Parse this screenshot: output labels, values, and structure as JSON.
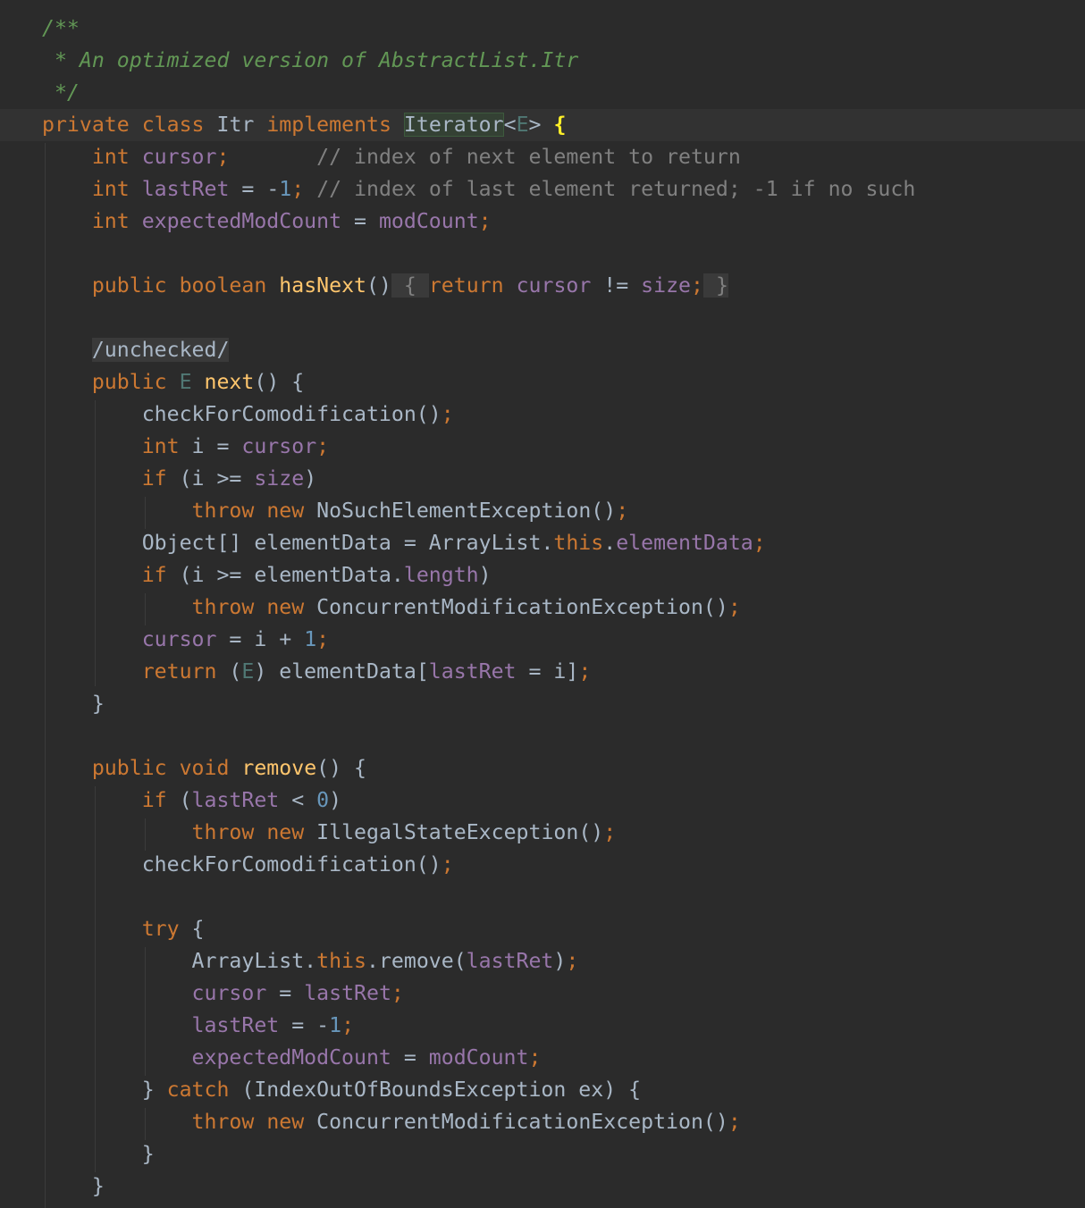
{
  "editor": {
    "colors": {
      "background": "#2b2b2b",
      "current_line": "#323232",
      "keyword": "#cc7832",
      "field": "#9876aa",
      "number": "#6897bb",
      "comment": "#808080",
      "doc_comment": "#629755",
      "method_decl": "#ffc66d",
      "type_param": "#507874",
      "default_text": "#a9b7c6"
    },
    "tokens": {
      "l1_doc": "/**",
      "l2_doc": " * An optimized version of AbstractList.Itr",
      "l3_doc": " */",
      "l4_private": "private",
      "l4_class": "class",
      "l4_name": "Itr",
      "l4_implements": "implements",
      "l4_iface": "Iterator",
      "l4_lt": "<",
      "l4_tp": "E",
      "l4_gt": ">",
      "l4_brace": "{",
      "l5_int": "int",
      "l5_field": "cursor",
      "l5_semi": ";",
      "l5_comment": "// index of next element to return",
      "l6_int": "int",
      "l6_field": "lastRet",
      "l6_eq": " = ",
      "l6_minus": "-",
      "l6_num": "1",
      "l6_semi": ";",
      "l6_comment": "// index of last element returned; -1 if no such",
      "l7_int": "int",
      "l7_field": "expectedModCount",
      "l7_eq": " = ",
      "l7_val": "modCount",
      "l7_semi": ";",
      "l8_public": "public",
      "l8_boolean": "boolean",
      "l8_method": "hasNext",
      "l8_parens": "()",
      "l8_open": " { ",
      "l8_return": "return",
      "l8_cursor": "cursor",
      "l8_ne": " != ",
      "l8_size": "size",
      "l8_semi": ";",
      "l8_close": " }",
      "l9_region": "/unchecked/",
      "l10_public": "public",
      "l10_tp": "E",
      "l10_method": "next",
      "l10_rest": "() {",
      "l11_call": "checkForComodification()",
      "l11_semi": ";",
      "l12_int": "int",
      "l12_i": " i = ",
      "l12_cursor": "cursor",
      "l12_semi": ";",
      "l13_if": "if",
      "l13_a": " (i >= ",
      "l13_size": "size",
      "l13_b": ")",
      "l14_throw": "throw",
      "l14_new": "new",
      "l14_ex": "NoSuchElementException()",
      "l14_semi": ";",
      "l15_a": "Object[] elementData = ArrayList.",
      "l15_this": "this",
      "l15_dot": ".",
      "l15_field": "elementData",
      "l15_semi": ";",
      "l16_if": "if",
      "l16_a": " (i >= elementData.",
      "l16_len": "length",
      "l16_b": ")",
      "l17_throw": "throw",
      "l17_new": "new",
      "l17_ex": "ConcurrentModificationException()",
      "l17_semi": ";",
      "l18_cursor": "cursor",
      "l18_a": " = i + ",
      "l18_num": "1",
      "l18_semi": ";",
      "l19_return": "return",
      "l19_a": " (",
      "l19_tp": "E",
      "l19_b": ") elementData[",
      "l19_field": "lastRet",
      "l19_c": " = i]",
      "l19_semi": ";",
      "l20_brace": "}",
      "l22_public": "public",
      "l22_void": "void",
      "l22_method": "remove",
      "l22_rest": "() {",
      "l23_if": "if",
      "l23_a": " (",
      "l23_field": "lastRet",
      "l23_b": " < ",
      "l23_num": "0",
      "l23_c": ")",
      "l24_throw": "throw",
      "l24_new": "new",
      "l24_ex": "IllegalStateException()",
      "l24_semi": ";",
      "l25_call": "checkForComodification()",
      "l25_semi": ";",
      "l27_try": "try",
      "l27_brace": " {",
      "l28_a": "ArrayList.",
      "l28_this": "this",
      "l28_b": ".remove(",
      "l28_field": "lastRet",
      "l28_c": ")",
      "l28_semi": ";",
      "l29_cursor": "cursor",
      "l29_eq": " = ",
      "l29_field": "lastRet",
      "l29_semi": ";",
      "l30_field": "lastRet",
      "l30_eq": " = ",
      "l30_minus": "-",
      "l30_num": "1",
      "l30_semi": ";",
      "l31_field": "expectedModCount",
      "l31_eq": " = ",
      "l31_val": "modCount",
      "l31_semi": ";",
      "l32_brace": "} ",
      "l32_catch": "catch",
      "l32_rest": " (IndexOutOfBoundsException ex) {",
      "l33_throw": "throw",
      "l33_new": "new",
      "l33_ex": "ConcurrentModificationException()",
      "l33_semi": ";",
      "l34_brace": "}",
      "l35_brace": "}"
    }
  }
}
